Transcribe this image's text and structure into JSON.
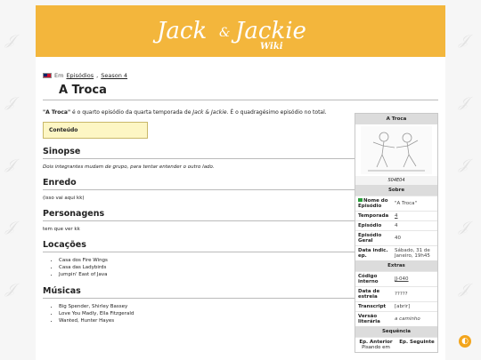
{
  "banner": {
    "title_left": "Jack",
    "title_amp": "&",
    "title_right": "Jackie",
    "subtitle": "Wiki"
  },
  "breadcrumb": {
    "label": "Em",
    "link1": "Episódios",
    "sep": ",",
    "link2": "Season 4"
  },
  "page_title": "A Troca",
  "intro": {
    "bold": "\"A Troca\"",
    "text1": " é o quarto episódio da quarta temporada de ",
    "show": "Jack & Jackie",
    "text2": ". É o quadragésimo episódio no total."
  },
  "toc_label": "Conteúdo",
  "sections": {
    "sinopse": {
      "title": "Sinopse",
      "text": "Dois integrantes mudam de grupo, para tentar entender o outro lado."
    },
    "enredo": {
      "title": "Enredo",
      "text": "(isso vai aqui kk)"
    },
    "personagens": {
      "title": "Personagens",
      "text": "tem que ver kk"
    },
    "locacoes": {
      "title": "Locações",
      "items": [
        "Casa dos Fire Wings",
        "Casa das Ladybirds",
        "Jumpin' East of Java"
      ]
    },
    "musicas": {
      "title": "Músicas",
      "items": [
        "Big Spender, Shirley Bassey",
        "Love You Madly, Ella Fitzgerald",
        "Wanted, Hunter Hayes"
      ]
    }
  },
  "infobox": {
    "title": "A Troca",
    "caption": "S04E04",
    "sobre": "Sobre",
    "rows": [
      {
        "k": "Nome do Episódio",
        "v": "\"A Troca\""
      },
      {
        "k": "Temporada",
        "v": "4"
      },
      {
        "k": "Episódio",
        "v": "4"
      },
      {
        "k": "Episódio Geral",
        "v": "40"
      },
      {
        "k": "Data indic. ep.",
        "v": "Sábado, 31 de Janeiro, 19h45"
      }
    ],
    "extras": "Extras",
    "extra_rows": [
      {
        "k": "Código interno",
        "v": "JJ-040"
      },
      {
        "k": "Data de estreia",
        "v": "?????"
      },
      {
        "k": "Transcript",
        "v": "[abrir]"
      },
      {
        "k": "Versão literária",
        "v": "a caminho"
      }
    ],
    "sequencia": "Sequência",
    "prev_label": "Ep. Anterior",
    "prev_title": "Pisando em",
    "next_label": "Ep. Seguinte"
  },
  "icons": {
    "theme_toggle": "theme-toggle-icon",
    "flag": "flag-icon"
  },
  "colors": {
    "banner": "#f3b63c",
    "toc_bg": "#fdf6c4",
    "accent": "#f3a51c"
  }
}
